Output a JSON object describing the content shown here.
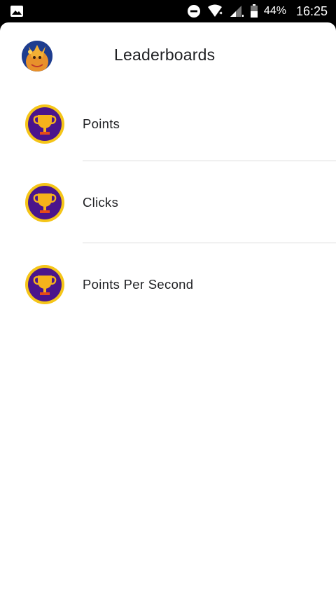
{
  "status_bar": {
    "left_icon": "image-icon",
    "icons": [
      "dnd-icon",
      "wifi-icon",
      "signal-icon",
      "battery-icon"
    ],
    "battery_percent": "44%",
    "time": "16:25"
  },
  "header": {
    "title": "Leaderboards",
    "avatar_icon": "player-avatar"
  },
  "leaderboards": [
    {
      "label": "Points",
      "icon": "trophy-icon"
    },
    {
      "label": "Clicks",
      "icon": "trophy-icon"
    },
    {
      "label": "Points Per Second",
      "icon": "trophy-icon"
    }
  ],
  "colors": {
    "trophy_ring": "#f5c518",
    "trophy_bg": "#4a148c",
    "trophy_cup": "#f5b21b",
    "divider": "#dcdcdc",
    "text": "#202124"
  }
}
